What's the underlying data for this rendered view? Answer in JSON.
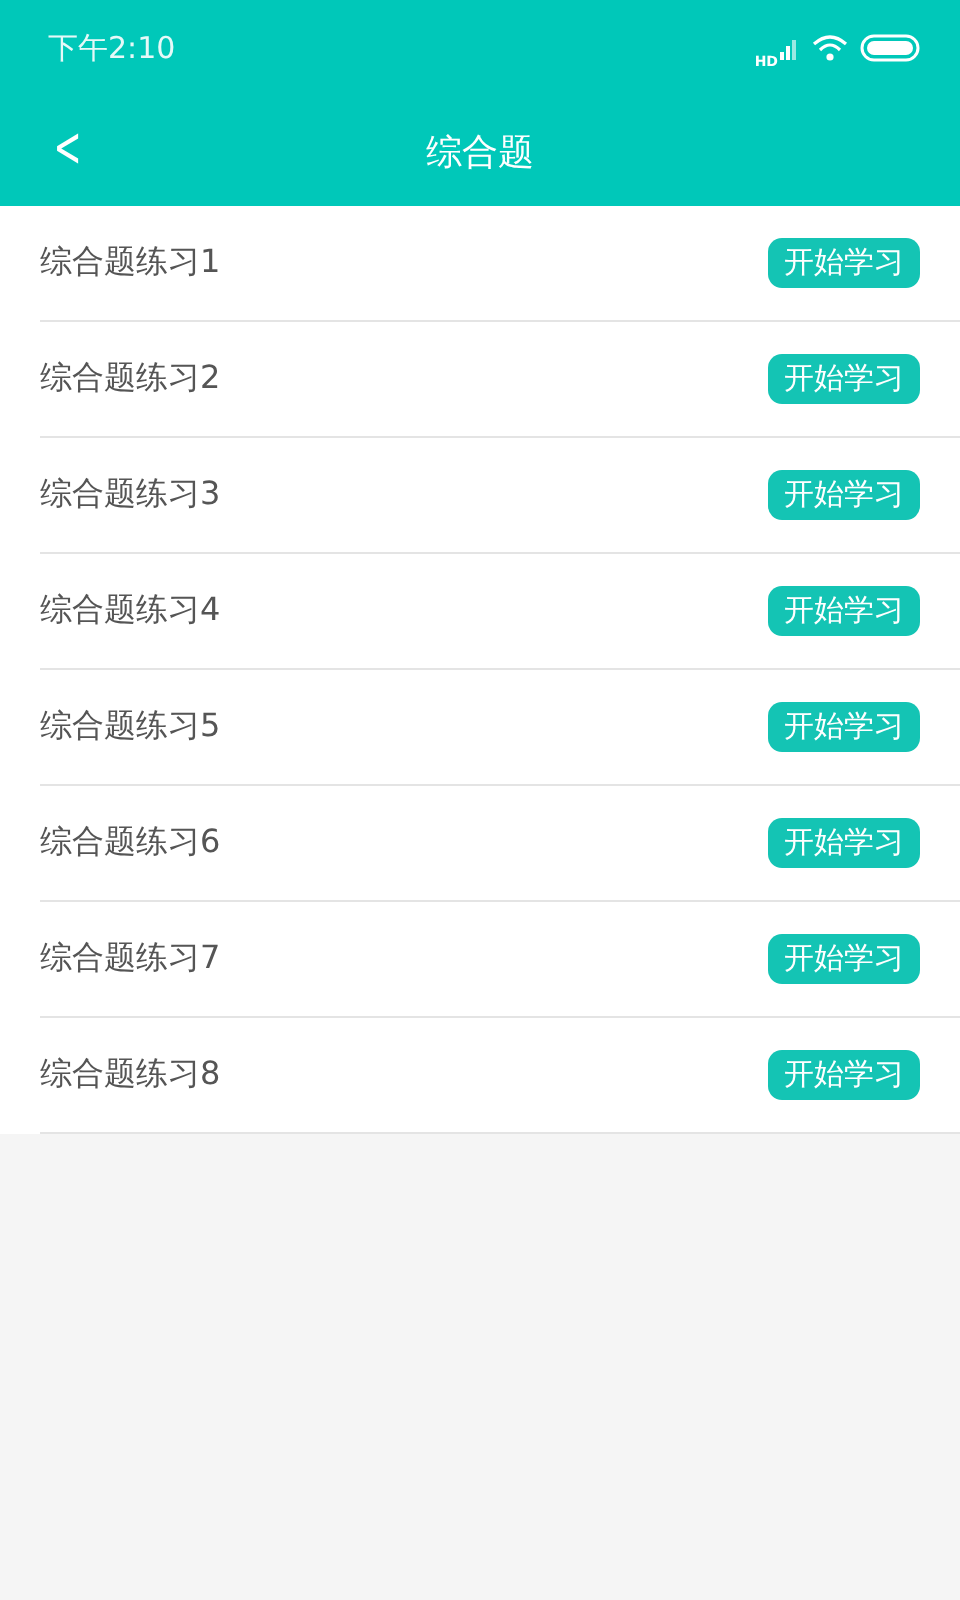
{
  "status_bar": {
    "time": "下午2:10",
    "network_label": "HD"
  },
  "header": {
    "back": "<",
    "title": "综合题"
  },
  "items": [
    {
      "title": "综合题练习1",
      "button": "开始学习"
    },
    {
      "title": "综合题练习2",
      "button": "开始学习"
    },
    {
      "title": "综合题练习3",
      "button": "开始学习"
    },
    {
      "title": "综合题练习4",
      "button": "开始学习"
    },
    {
      "title": "综合题练习5",
      "button": "开始学习"
    },
    {
      "title": "综合题练习6",
      "button": "开始学习"
    },
    {
      "title": "综合题练习7",
      "button": "开始学习"
    },
    {
      "title": "综合题练习8",
      "button": "开始学习"
    }
  ]
}
